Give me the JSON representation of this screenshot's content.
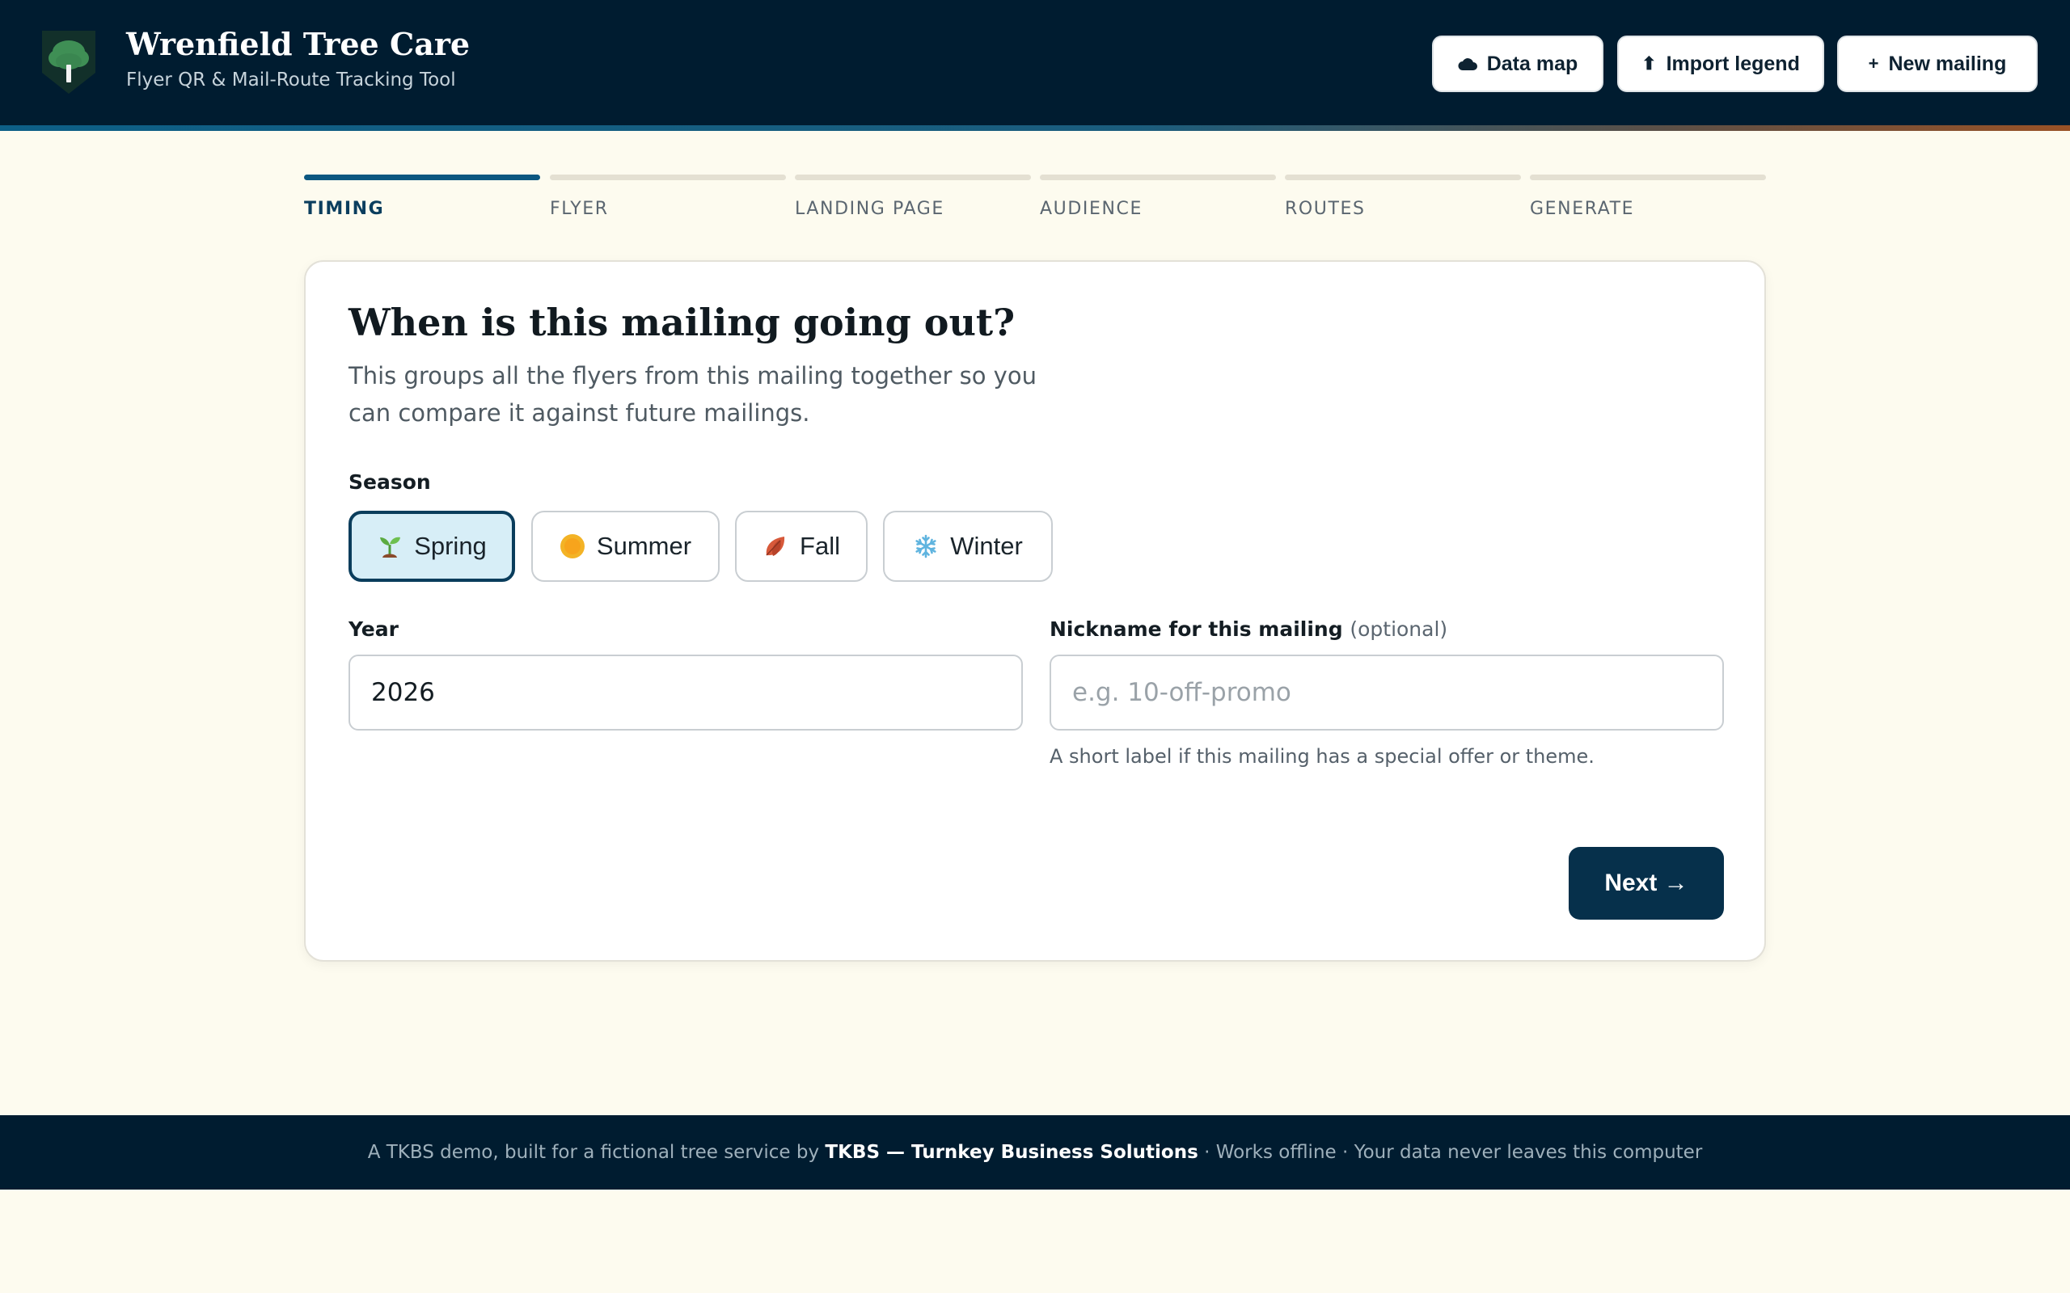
{
  "app": {
    "title": "Wrenfield Tree Care",
    "subtitle": "Flyer QR & Mail-Route Tracking Tool",
    "logo_icon": "tree-shield-icon"
  },
  "header_actions": [
    {
      "label": "Data map",
      "icon": "cloud-icon"
    },
    {
      "label": "Import legend",
      "icon": "upload-arrow-icon",
      "glyph": "⬆"
    },
    {
      "label": "New mailing",
      "icon": "plus-icon",
      "glyph": "+"
    }
  ],
  "steps": [
    {
      "label": "TIMING",
      "active": true
    },
    {
      "label": "FLYER",
      "active": false
    },
    {
      "label": "LANDING PAGE",
      "active": false
    },
    {
      "label": "AUDIENCE",
      "active": false
    },
    {
      "label": "ROUTES",
      "active": false
    },
    {
      "label": "GENERATE",
      "active": false
    }
  ],
  "form": {
    "title": "When is this mailing going out?",
    "description": "This groups all the flyers from this mailing together so you can compare it against future mailings.",
    "season_label": "Season",
    "seasons": [
      {
        "label": "Spring",
        "icon": "seedling-icon",
        "selected": true
      },
      {
        "label": "Summer",
        "icon": "sun-icon",
        "selected": false
      },
      {
        "label": "Fall",
        "icon": "fallen-leaf-icon",
        "selected": false
      },
      {
        "label": "Winter",
        "icon": "snowflake-icon",
        "selected": false
      }
    ],
    "year_label": "Year",
    "year_value": "2026",
    "nickname_label": "Nickname for this mailing",
    "nickname_optional": "(optional)",
    "nickname_value": "",
    "nickname_placeholder": "e.g. 10-off-promo",
    "nickname_help": "A short label if this mailing has a special offer or theme.",
    "next_label": "Next →"
  },
  "footer": {
    "prefix": "A TKBS demo, built for a fictional tree service by",
    "brand": "TKBS — Turnkey Business Solutions",
    "suffix": "· Works offline · Your data never leaves this computer"
  },
  "colors": {
    "header_bg": "#001c30",
    "page_bg": "#fdfbef",
    "accent": "#0c5780",
    "primary_button": "#06304b",
    "selected_season_bg": "#d7eef7"
  }
}
